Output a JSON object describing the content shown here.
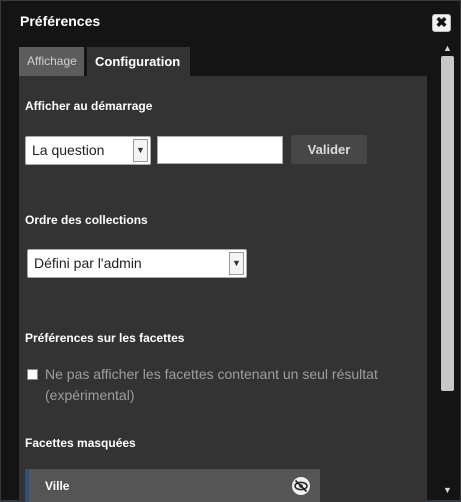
{
  "dialog": {
    "title": "Préférences",
    "close_icon": "close-icon"
  },
  "tabs": [
    {
      "label": "Affichage",
      "active": false
    },
    {
      "label": "Configuration",
      "active": true
    }
  ],
  "startup": {
    "heading": "Afficher au démarrage",
    "select_value": "La question",
    "input_value": "",
    "validate_label": "Valider"
  },
  "collections": {
    "heading": "Ordre des collections",
    "select_value": "Défini par l'admin"
  },
  "facets_prefs": {
    "heading": "Préférences sur les facettes",
    "checkbox_checked": false,
    "checkbox_label": "Ne pas afficher les facettes contenant un seul résultat (expérimental)"
  },
  "hidden_facets": {
    "heading": "Facettes masquées",
    "items": [
      {
        "label": "Ville",
        "icon": "eye-slash-icon"
      }
    ]
  },
  "colors": {
    "dialog_bg": "#141414",
    "panel_bg": "#333333",
    "facet_accent": "#2f4f78"
  }
}
